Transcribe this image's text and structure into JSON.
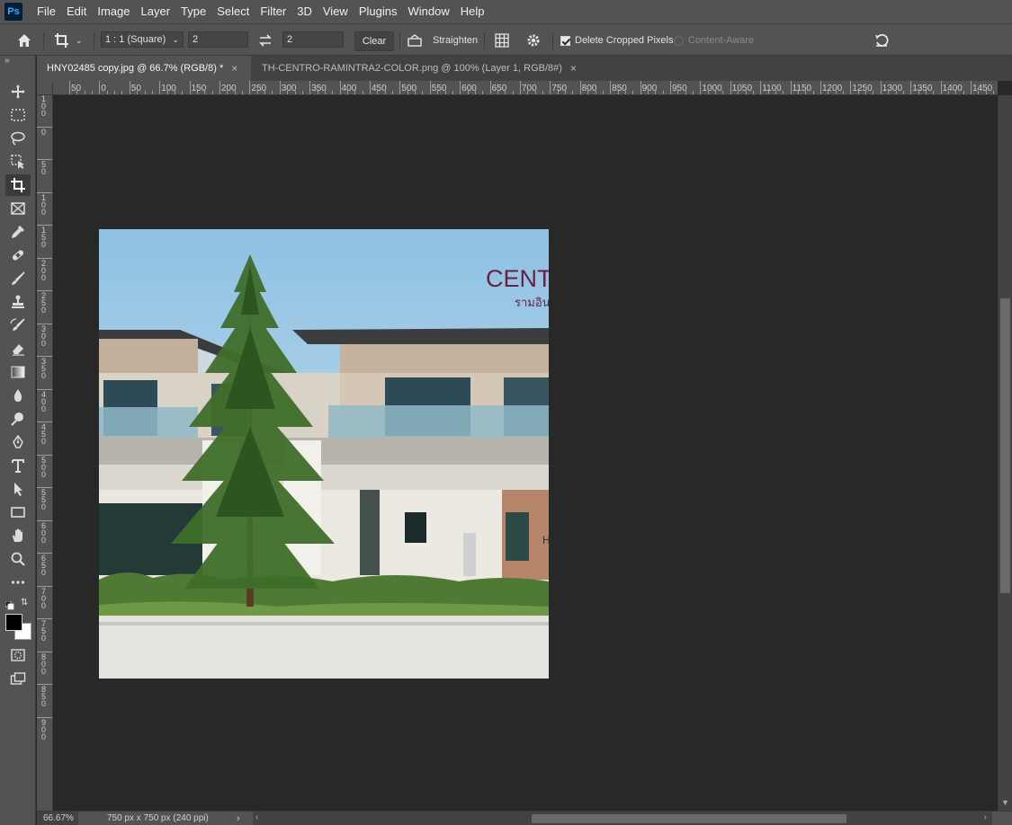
{
  "app": {
    "logo": "Ps"
  },
  "menu": [
    "File",
    "Edit",
    "Image",
    "Layer",
    "Type",
    "Select",
    "Filter",
    "3D",
    "View",
    "Plugins",
    "Window",
    "Help"
  ],
  "options": {
    "ratio_preset": "1 : 1 (Square)",
    "width_value": "2",
    "height_value": "2",
    "clear_label": "Clear",
    "straighten_label": "Straighten",
    "delete_cropped_label": "Delete Cropped Pixels",
    "delete_cropped_checked": true,
    "content_aware_label": "Content-Aware"
  },
  "tabs": [
    {
      "label": "HNY02485 copy.jpg @ 66.7% (RGB/8) *",
      "active": true
    },
    {
      "label": "TH-CENTRO-RAMINTRA2-COLOR.png @ 100% (Layer 1, RGB/8#)",
      "active": false
    }
  ],
  "ruler_top": [
    "50",
    "0",
    "50",
    "100",
    "150",
    "200",
    "250",
    "300",
    "350",
    "400",
    "450",
    "500",
    "550",
    "600",
    "650",
    "700",
    "750",
    "800",
    "850",
    "900",
    "950",
    "1000",
    "1050",
    "1100",
    "1150",
    "1200",
    "1250",
    "1300",
    "1350",
    "1400",
    "1450"
  ],
  "ruler_left": [
    "1 0 0",
    "0",
    "5 0",
    "1 0 0",
    "1 5 0",
    "2 0 0",
    "2 5 0",
    "3 0 0",
    "3 5 0",
    "4 0 0",
    "4 5 0",
    "5 0 0",
    "5 5 0",
    "6 0 0",
    "6 5 0",
    "7 0 0",
    "7 5 0",
    "8 0 0",
    "8 5 0",
    "9 0 0"
  ],
  "artwork": {
    "logo_text": "CENT",
    "thai_text": "รามอิน",
    "sign_letter": "H"
  },
  "tools": [
    "move-icon",
    "marquee-icon",
    "lasso-icon",
    "object-select-icon",
    "crop-icon",
    "frame-icon",
    "eyedropper-icon",
    "healing-icon",
    "brush-icon",
    "stamp-icon",
    "history-brush-icon",
    "eraser-icon",
    "gradient-icon",
    "blur-icon",
    "dodge-icon",
    "pen-icon",
    "type-icon",
    "path-select-icon",
    "rectangle-icon",
    "hand-icon",
    "zoom-icon",
    "more-icon"
  ],
  "status": {
    "zoom": "66.67%",
    "doc_info": "750 px x 750 px (240 ppi)"
  },
  "colors": {
    "foreground": "#000000",
    "background": "#ffffff",
    "panel": "#535353",
    "canvas": "#282828"
  }
}
